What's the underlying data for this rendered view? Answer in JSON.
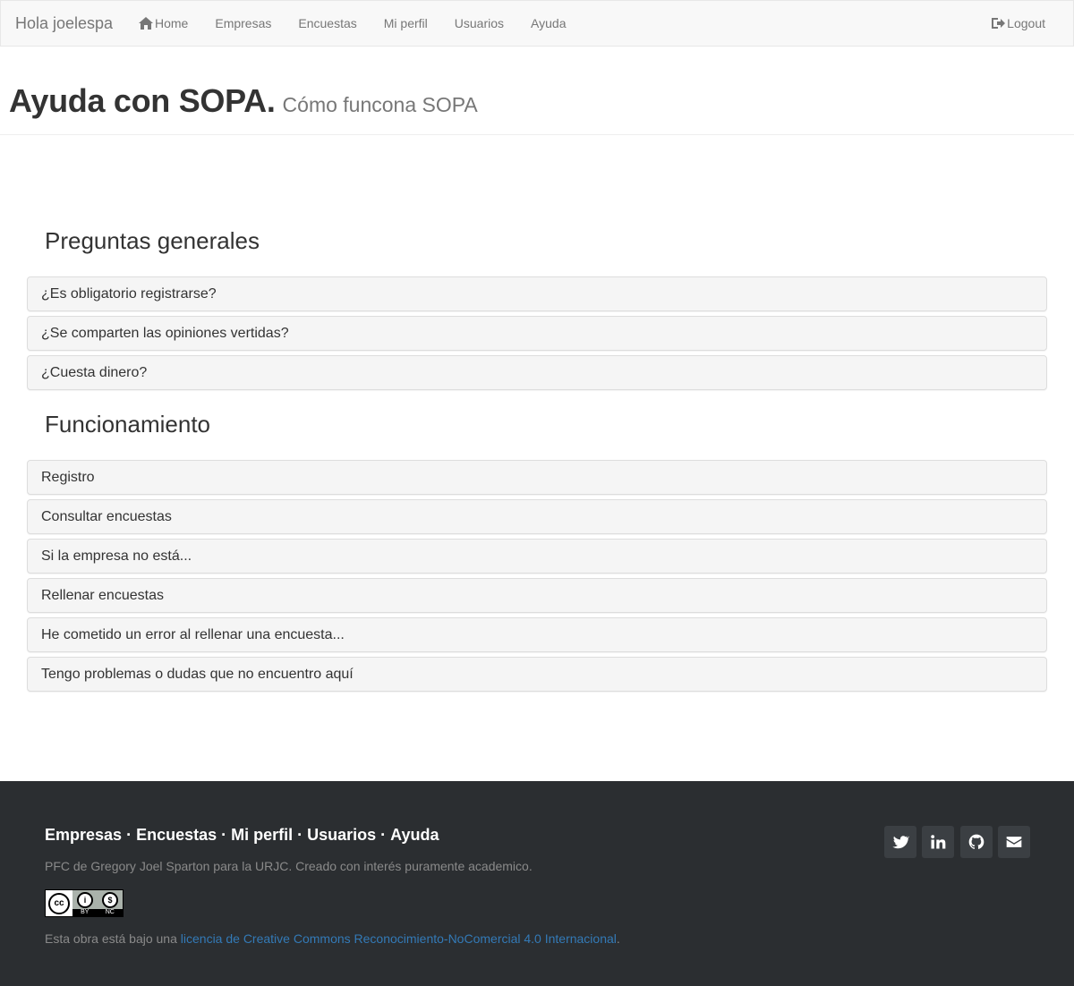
{
  "navbar": {
    "brand": "Hola joelespa",
    "items": [
      {
        "label": "Home",
        "icon": "home-icon"
      },
      {
        "label": "Empresas"
      },
      {
        "label": "Encuestas"
      },
      {
        "label": "Mi perfil"
      },
      {
        "label": "Usuarios"
      },
      {
        "label": "Ayuda"
      }
    ],
    "logout": {
      "label": "Logout",
      "icon": "logout-icon"
    }
  },
  "header": {
    "title": "Ayuda con SOPA.",
    "subtitle": "Cómo funcona SOPA"
  },
  "sections": [
    {
      "title": "Preguntas generales",
      "panels": [
        "¿Es obligatorio registrarse?",
        "¿Se comparten las opiniones vertidas?",
        "¿Cuesta dinero?"
      ]
    },
    {
      "title": "Funcionamiento",
      "panels": [
        "Registro",
        "Consultar encuestas",
        "Si la empresa no está...",
        "Rellenar encuestas",
        "He cometido un error al rellenar una encuesta...",
        "Tengo problemas o dudas que no encuentro aquí"
      ]
    }
  ],
  "footer": {
    "links": [
      "Empresas",
      "Encuestas",
      "Mi perfil",
      "Usuarios",
      "Ayuda"
    ],
    "separator": "·",
    "credit": "PFC de Gregory Joel Sparton para la URJC. Creado con interés puramente academico.",
    "cc_badge": {
      "main": "cc",
      "by": "BY",
      "nc": "NC"
    },
    "license_prefix": "Esta obra está bajo una ",
    "license_link": "licencia de Creative Commons Reconocimiento-NoComercial 4.0 Internacional",
    "license_suffix": ".",
    "social": [
      "twitter-icon",
      "linkedin-icon",
      "github-icon",
      "envelope-icon"
    ]
  },
  "colors": {
    "navbar_bg": "#f8f8f8",
    "footer_bg": "#2b2e31",
    "panel_bg": "#f5f5f5",
    "link": "#337ab7"
  }
}
